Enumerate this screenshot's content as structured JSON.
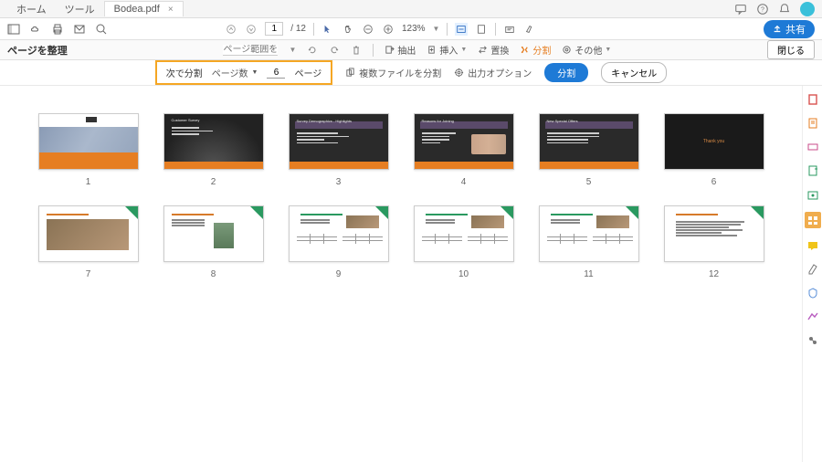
{
  "tabs": {
    "home": "ホーム",
    "tools": "ツール",
    "file": "Bodea.pdf"
  },
  "share_label": "共有",
  "page": {
    "current": "1",
    "total": "/ 12"
  },
  "zoom": "123%",
  "organize": {
    "title": "ページを整理",
    "range_placeholder": "ページ範囲を入力",
    "extract": "抽出",
    "insert": "挿入",
    "replace": "置換",
    "split": "分割",
    "other": "その他",
    "close": "閉じる"
  },
  "split_bar": {
    "split_by": "次で分割",
    "mode": "ページ数",
    "value": "6",
    "unit": "ページ",
    "split_multiple": "複数ファイルを分割",
    "output_options": "出力オプション",
    "split_btn": "分割",
    "cancel_btn": "キャンセル"
  },
  "thumbs": {
    "t2_title": "Customer Survey",
    "t3_title": "Survey Demographics - Highlights",
    "t4_title": "Reasons for Joining",
    "t5_title": "New Special Offers",
    "t6_title": "Thank you"
  },
  "side_colors": [
    "#d9534f",
    "#e67e22",
    "#c94b8a",
    "#2a9960",
    "#2a9960",
    "#f0ad4e",
    "#f0c419",
    "#777",
    "#b85cbf",
    "#777"
  ]
}
